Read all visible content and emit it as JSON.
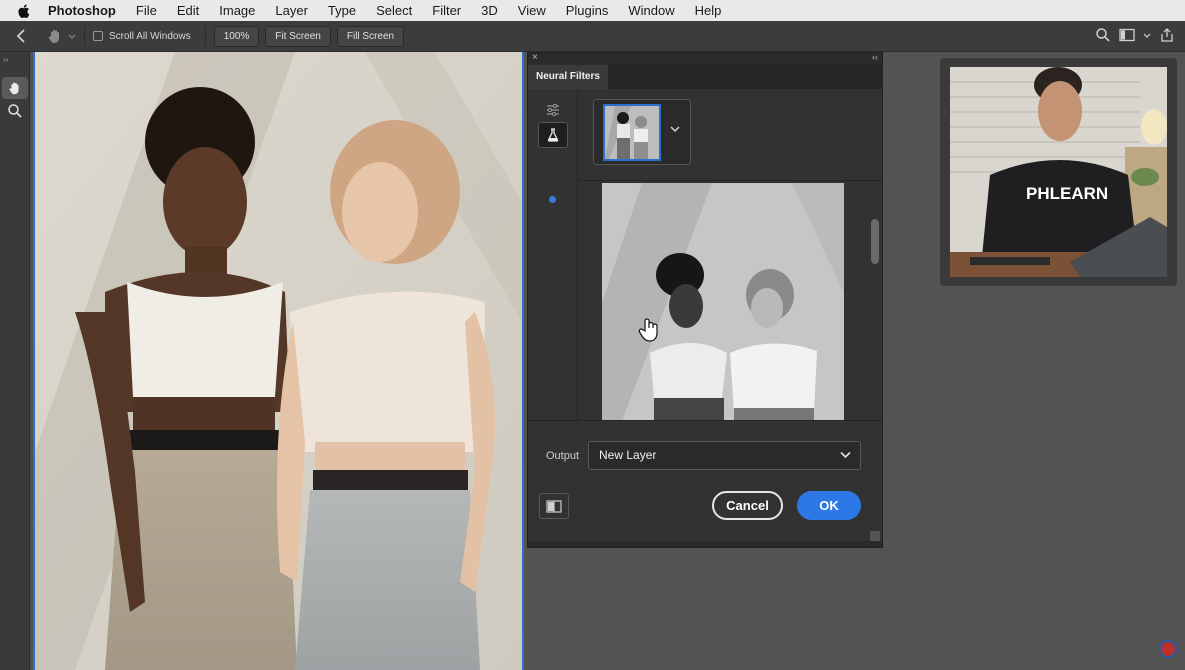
{
  "menubar": {
    "app_name": "Photoshop",
    "items": [
      "File",
      "Edit",
      "Image",
      "Layer",
      "Type",
      "Select",
      "Filter",
      "3D",
      "View",
      "Plugins",
      "Window",
      "Help"
    ]
  },
  "options_bar": {
    "scroll_all_windows_label": "Scroll All Windows",
    "zoom_100_label": "100%",
    "fit_screen_label": "Fit Screen",
    "fill_screen_label": "Fill Screen"
  },
  "panel": {
    "tab_label": "Neural Filters",
    "output_label": "Output",
    "output_value": "New Layer",
    "cancel_label": "Cancel",
    "ok_label": "OK"
  },
  "webcam": {
    "shirt_text": "PHLEARN"
  },
  "colors": {
    "accent": "#2c78e6",
    "doc_border": "#2d6fcf",
    "panel_bg": "#323232",
    "canvas_bg": "#535353"
  }
}
